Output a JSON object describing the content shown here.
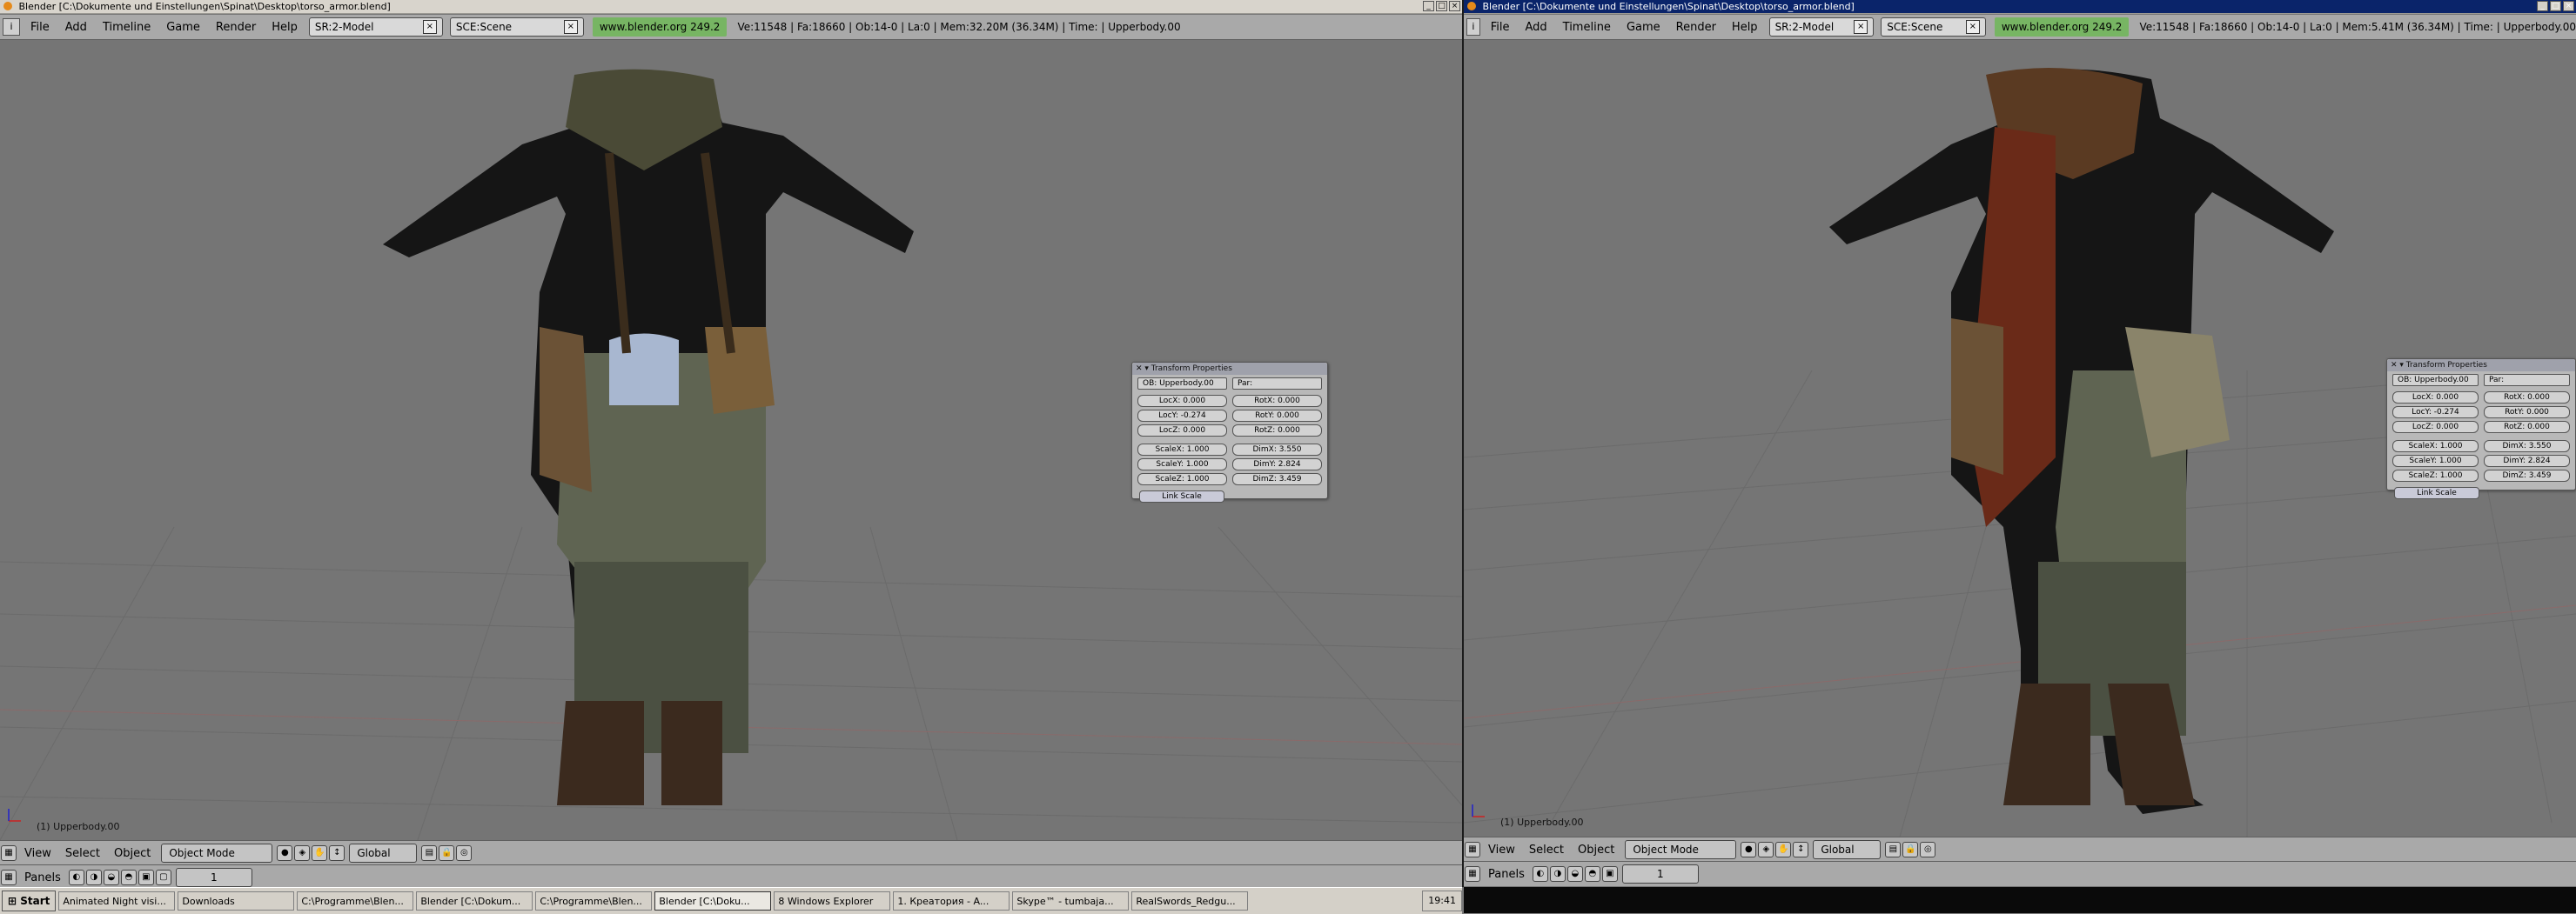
{
  "left": {
    "title": "Blender [C:\\Dokumente und Einstellungen\\Spinat\\Desktop\\torso_armor.blend]",
    "menus": [
      "File",
      "Add",
      "Timeline",
      "Game",
      "Render",
      "Help"
    ],
    "screen_field": "SR:2-Model",
    "scene_field": "SCE:Scene",
    "link": "www.blender.org 249.2",
    "stats": "Ve:11548 | Fa:18660 | Ob:14-0 | La:0  | Mem:32.20M (36.34M)  | Time: | Upperbody.00",
    "viewport_label": "(1) Upperbody.00",
    "header": {
      "menus": [
        "View",
        "Select",
        "Object"
      ],
      "mode": "Object Mode",
      "orientation": "Global"
    },
    "panels": {
      "label": "Panels",
      "frame": "1"
    }
  },
  "right": {
    "title": "Blender [C:\\Dokumente und Einstellungen\\Spinat\\Desktop\\torso_armor.blend]",
    "menus": [
      "File",
      "Add",
      "Timeline",
      "Game",
      "Render",
      "Help"
    ],
    "screen_field": "SR:2-Model",
    "scene_field": "SCE:Scene",
    "link": "www.blender.org 249.2",
    "stats": "Ve:11548 | Fa:18660 | Ob:14-0 | La:0  | Mem:5.41M (36.34M)  | Time: | Upperbody.00",
    "viewport_label": "(1) Upperbody.00",
    "header": {
      "menus": [
        "View",
        "Select",
        "Object"
      ],
      "mode": "Object Mode",
      "orientation": "Global"
    },
    "panels": {
      "label": "Panels",
      "frame": "1"
    }
  },
  "transform": {
    "title": "Transform Properties",
    "ob": "OB: Upperbody.00",
    "par": "Par:",
    "loc": [
      "LocX: 0.000",
      "LocY: -0.274",
      "LocZ: 0.000"
    ],
    "rot": [
      "RotX: 0.000",
      "RotY: 0.000",
      "RotZ: 0.000"
    ],
    "scale": [
      "ScaleX: 1.000",
      "ScaleY: 1.000",
      "ScaleZ: 1.000"
    ],
    "dim": [
      "DimX: 3.550",
      "DimY: 2.824",
      "DimZ: 3.459"
    ],
    "link_scale": "Link Scale"
  },
  "taskbar": {
    "start": "Start",
    "tasks": [
      "Animated Night visi...",
      "Downloads",
      "C:\\Programme\\Blen...",
      "Blender [C:\\Dokum...",
      "C:\\Programme\\Blen...",
      "Blender [C:\\Doku...",
      "8 Windows Explorer",
      "1. Креатория - A...",
      "Skype™ - tumbaja...",
      "RealSwords_Redgu..."
    ],
    "clock": "19:41"
  },
  "colors": {
    "link_green": "#77b563",
    "viewport_grey": "#757575",
    "panel_header": "#9fa1ab"
  },
  "icons": [
    "blender-logo-icon",
    "close-icon",
    "minimize-icon",
    "maximize-icon",
    "axis-icon",
    "start-logo-icon"
  ]
}
